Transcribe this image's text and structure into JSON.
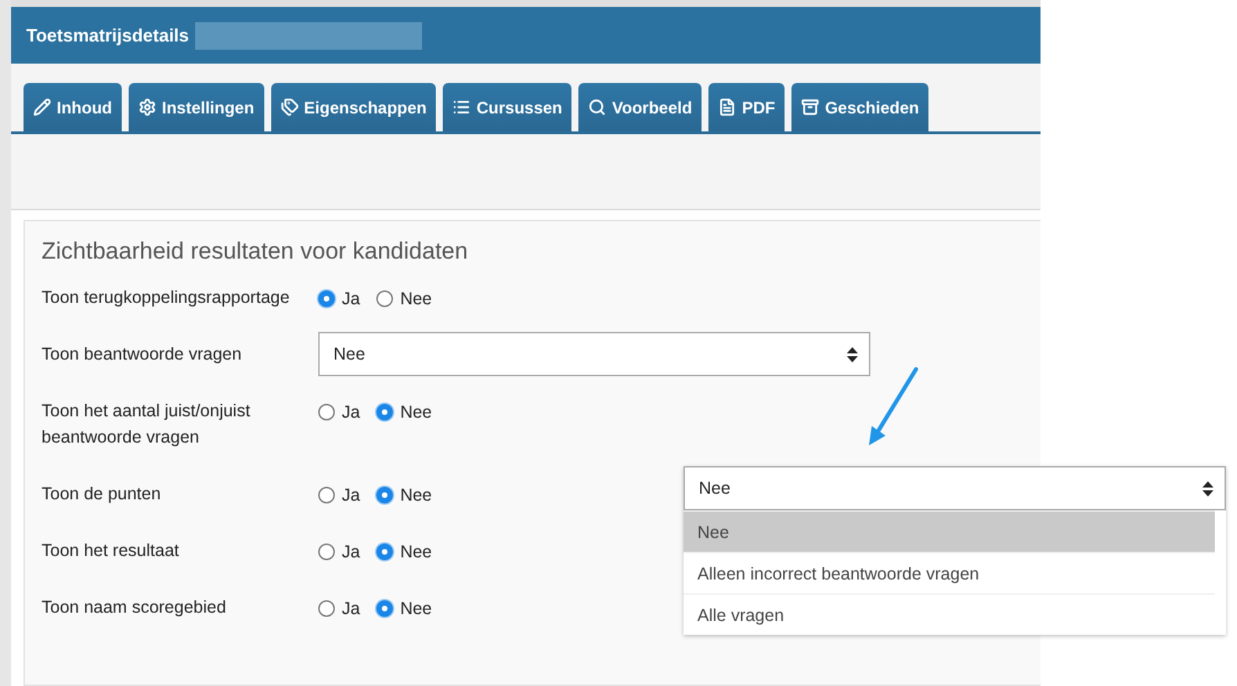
{
  "header": {
    "title": "Toetsmatrijsdetails"
  },
  "tabs": [
    {
      "label": "Inhoud"
    },
    {
      "label": "Instellingen"
    },
    {
      "label": "Eigenschappen"
    },
    {
      "label": "Cursussen"
    },
    {
      "label": "Voorbeeld"
    },
    {
      "label": "PDF"
    },
    {
      "label": "Geschieden"
    }
  ],
  "section": {
    "title": "Zichtbaarheid resultaten voor kandidaten",
    "rows": [
      {
        "kind": "radio",
        "label": "Toon terugkoppelingsrapportage",
        "options": [
          {
            "label": "Ja",
            "selected": true
          },
          {
            "label": "Nee",
            "selected": false
          }
        ]
      },
      {
        "kind": "select",
        "label": "Toon beantwoorde vragen",
        "value": "Nee"
      },
      {
        "kind": "radio",
        "label": "Toon het aantal juist/onjuist beantwoorde vragen",
        "options": [
          {
            "label": "Ja",
            "selected": false
          },
          {
            "label": "Nee",
            "selected": true
          }
        ]
      },
      {
        "kind": "radio",
        "label": "Toon de punten",
        "options": [
          {
            "label": "Ja",
            "selected": false
          },
          {
            "label": "Nee",
            "selected": true
          }
        ]
      },
      {
        "kind": "radio",
        "label": "Toon het resultaat",
        "options": [
          {
            "label": "Ja",
            "selected": false
          },
          {
            "label": "Nee",
            "selected": true
          }
        ]
      },
      {
        "kind": "radio",
        "label": "Toon naam scoregebied",
        "options": [
          {
            "label": "Ja",
            "selected": false
          },
          {
            "label": "Nee",
            "selected": true
          }
        ]
      }
    ]
  },
  "dropdown_popup": {
    "value": "Nee",
    "options": [
      {
        "label": "Nee",
        "selected": true
      },
      {
        "label": "Alleen incorrect beantwoorde vragen",
        "selected": false
      },
      {
        "label": "Alle vragen",
        "selected": false
      }
    ]
  }
}
